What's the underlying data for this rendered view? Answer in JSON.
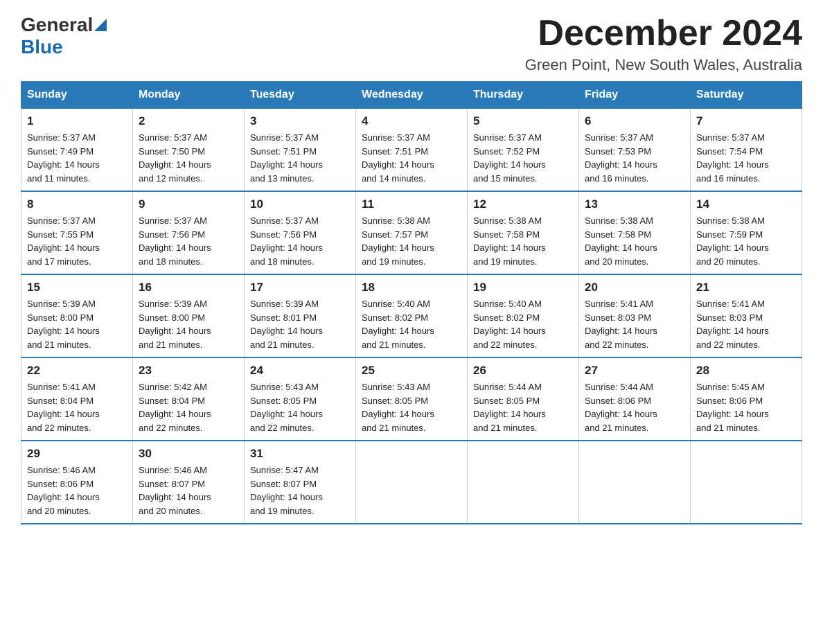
{
  "logo": {
    "general": "General",
    "blue": "Blue"
  },
  "header": {
    "month_year": "December 2024",
    "location": "Green Point, New South Wales, Australia"
  },
  "days_of_week": [
    "Sunday",
    "Monday",
    "Tuesday",
    "Wednesday",
    "Thursday",
    "Friday",
    "Saturday"
  ],
  "weeks": [
    [
      {
        "day": "1",
        "sunrise": "5:37 AM",
        "sunset": "7:49 PM",
        "daylight": "14 hours and 11 minutes."
      },
      {
        "day": "2",
        "sunrise": "5:37 AM",
        "sunset": "7:50 PM",
        "daylight": "14 hours and 12 minutes."
      },
      {
        "day": "3",
        "sunrise": "5:37 AM",
        "sunset": "7:51 PM",
        "daylight": "14 hours and 13 minutes."
      },
      {
        "day": "4",
        "sunrise": "5:37 AM",
        "sunset": "7:51 PM",
        "daylight": "14 hours and 14 minutes."
      },
      {
        "day": "5",
        "sunrise": "5:37 AM",
        "sunset": "7:52 PM",
        "daylight": "14 hours and 15 minutes."
      },
      {
        "day": "6",
        "sunrise": "5:37 AM",
        "sunset": "7:53 PM",
        "daylight": "14 hours and 16 minutes."
      },
      {
        "day": "7",
        "sunrise": "5:37 AM",
        "sunset": "7:54 PM",
        "daylight": "14 hours and 16 minutes."
      }
    ],
    [
      {
        "day": "8",
        "sunrise": "5:37 AM",
        "sunset": "7:55 PM",
        "daylight": "14 hours and 17 minutes."
      },
      {
        "day": "9",
        "sunrise": "5:37 AM",
        "sunset": "7:56 PM",
        "daylight": "14 hours and 18 minutes."
      },
      {
        "day": "10",
        "sunrise": "5:37 AM",
        "sunset": "7:56 PM",
        "daylight": "14 hours and 18 minutes."
      },
      {
        "day": "11",
        "sunrise": "5:38 AM",
        "sunset": "7:57 PM",
        "daylight": "14 hours and 19 minutes."
      },
      {
        "day": "12",
        "sunrise": "5:38 AM",
        "sunset": "7:58 PM",
        "daylight": "14 hours and 19 minutes."
      },
      {
        "day": "13",
        "sunrise": "5:38 AM",
        "sunset": "7:58 PM",
        "daylight": "14 hours and 20 minutes."
      },
      {
        "day": "14",
        "sunrise": "5:38 AM",
        "sunset": "7:59 PM",
        "daylight": "14 hours and 20 minutes."
      }
    ],
    [
      {
        "day": "15",
        "sunrise": "5:39 AM",
        "sunset": "8:00 PM",
        "daylight": "14 hours and 21 minutes."
      },
      {
        "day": "16",
        "sunrise": "5:39 AM",
        "sunset": "8:00 PM",
        "daylight": "14 hours and 21 minutes."
      },
      {
        "day": "17",
        "sunrise": "5:39 AM",
        "sunset": "8:01 PM",
        "daylight": "14 hours and 21 minutes."
      },
      {
        "day": "18",
        "sunrise": "5:40 AM",
        "sunset": "8:02 PM",
        "daylight": "14 hours and 21 minutes."
      },
      {
        "day": "19",
        "sunrise": "5:40 AM",
        "sunset": "8:02 PM",
        "daylight": "14 hours and 22 minutes."
      },
      {
        "day": "20",
        "sunrise": "5:41 AM",
        "sunset": "8:03 PM",
        "daylight": "14 hours and 22 minutes."
      },
      {
        "day": "21",
        "sunrise": "5:41 AM",
        "sunset": "8:03 PM",
        "daylight": "14 hours and 22 minutes."
      }
    ],
    [
      {
        "day": "22",
        "sunrise": "5:41 AM",
        "sunset": "8:04 PM",
        "daylight": "14 hours and 22 minutes."
      },
      {
        "day": "23",
        "sunrise": "5:42 AM",
        "sunset": "8:04 PM",
        "daylight": "14 hours and 22 minutes."
      },
      {
        "day": "24",
        "sunrise": "5:43 AM",
        "sunset": "8:05 PM",
        "daylight": "14 hours and 22 minutes."
      },
      {
        "day": "25",
        "sunrise": "5:43 AM",
        "sunset": "8:05 PM",
        "daylight": "14 hours and 21 minutes."
      },
      {
        "day": "26",
        "sunrise": "5:44 AM",
        "sunset": "8:05 PM",
        "daylight": "14 hours and 21 minutes."
      },
      {
        "day": "27",
        "sunrise": "5:44 AM",
        "sunset": "8:06 PM",
        "daylight": "14 hours and 21 minutes."
      },
      {
        "day": "28",
        "sunrise": "5:45 AM",
        "sunset": "8:06 PM",
        "daylight": "14 hours and 21 minutes."
      }
    ],
    [
      {
        "day": "29",
        "sunrise": "5:46 AM",
        "sunset": "8:06 PM",
        "daylight": "14 hours and 20 minutes."
      },
      {
        "day": "30",
        "sunrise": "5:46 AM",
        "sunset": "8:07 PM",
        "daylight": "14 hours and 20 minutes."
      },
      {
        "day": "31",
        "sunrise": "5:47 AM",
        "sunset": "8:07 PM",
        "daylight": "14 hours and 19 minutes."
      },
      null,
      null,
      null,
      null
    ]
  ],
  "labels": {
    "sunrise": "Sunrise:",
    "sunset": "Sunset:",
    "daylight": "Daylight:"
  }
}
